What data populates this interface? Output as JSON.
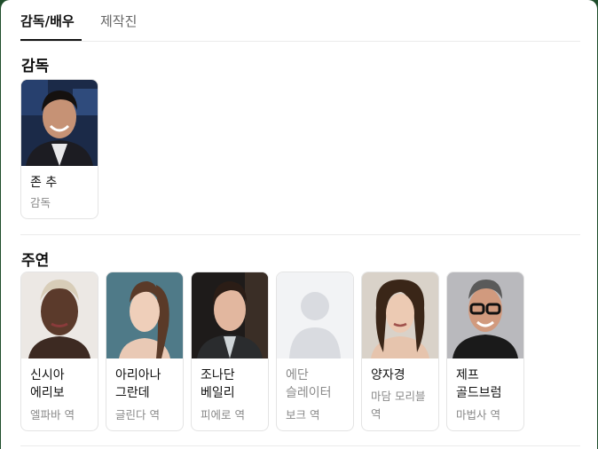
{
  "tabs": [
    {
      "label": "감독/배우",
      "active": true
    },
    {
      "label": "제작진",
      "active": false
    }
  ],
  "directors": {
    "title": "감독",
    "people": [
      {
        "name": "존 추",
        "role": "감독",
        "photo": "photo"
      }
    ]
  },
  "cast": {
    "title": "주연",
    "people": [
      {
        "name": "신시아 에리보",
        "role": "엘파바 역",
        "photo": "photo"
      },
      {
        "name": "아리아나 그란데",
        "role": "글린다 역",
        "photo": "photo"
      },
      {
        "name": "조나단 베일리",
        "role": "피에로 역",
        "photo": "photo"
      },
      {
        "name": "에단 슬레이터",
        "role": "보크 역",
        "photo": "placeholder"
      },
      {
        "name": "양자경",
        "role": "마담 모리블 역",
        "photo": "photo"
      },
      {
        "name": "제프 골드브럼",
        "role": "마법사 역",
        "photo": "photo"
      }
    ]
  },
  "colors": {
    "frame": "#1f4d2b",
    "text": "#111111",
    "muted": "#8a8a8a",
    "border": "#e4e4e4"
  }
}
